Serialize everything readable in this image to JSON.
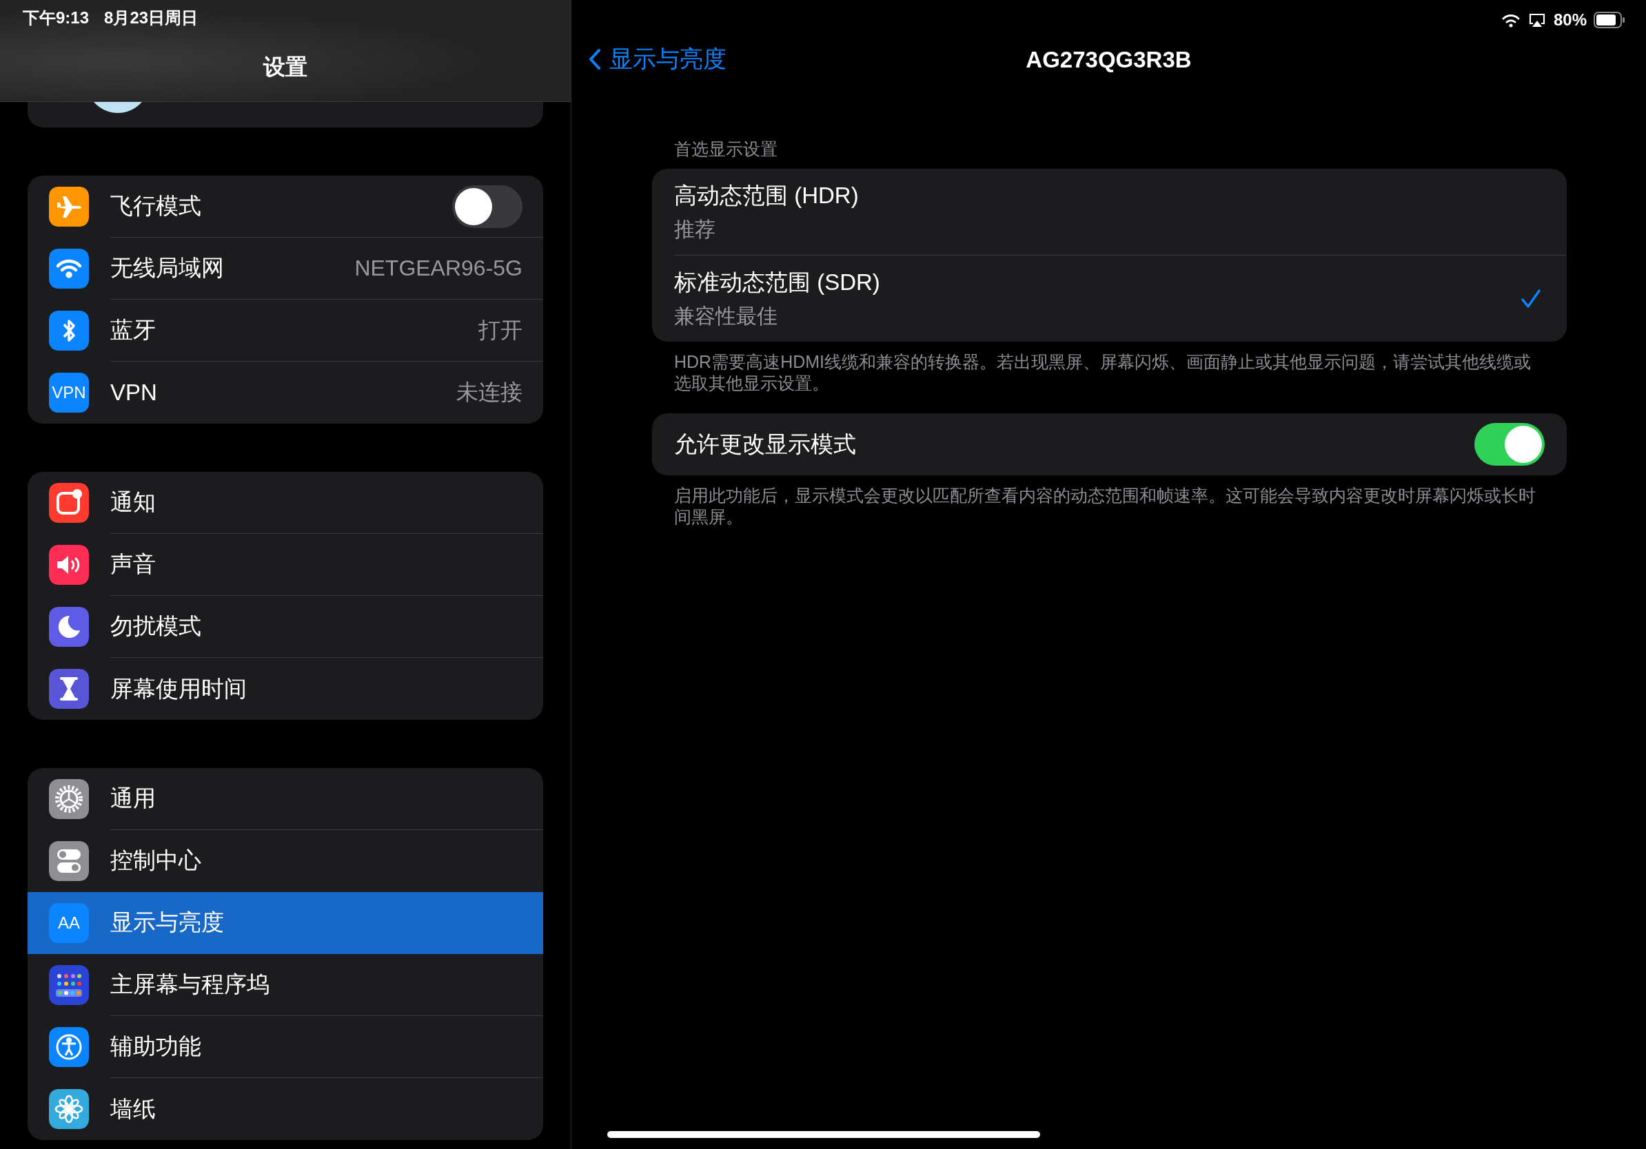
{
  "status_bar": {
    "time": "下午9:13",
    "date": "8月23日周日",
    "battery": "80%"
  },
  "sidebar": {
    "title": "设置",
    "groups": [
      {
        "items": [
          {
            "kind": "toggle",
            "label": "飞行模式",
            "on": false,
            "selected": false
          },
          {
            "kind": "value",
            "label": "无线局域网",
            "value": "NETGEAR96-5G",
            "selected": false
          },
          {
            "kind": "value",
            "label": "蓝牙",
            "value": "打开",
            "selected": false
          },
          {
            "kind": "value",
            "label": "VPN",
            "value": "未连接",
            "icon_text": "VPN",
            "selected": false
          }
        ]
      },
      {
        "items": [
          {
            "kind": "link",
            "label": "通知",
            "selected": false
          },
          {
            "kind": "link",
            "label": "声音",
            "selected": false
          },
          {
            "kind": "link",
            "label": "勿扰模式",
            "selected": false
          },
          {
            "kind": "link",
            "label": "屏幕使用时间",
            "selected": false
          }
        ]
      },
      {
        "items": [
          {
            "kind": "link",
            "label": "通用",
            "selected": false
          },
          {
            "kind": "link",
            "label": "控制中心",
            "selected": false
          },
          {
            "kind": "link",
            "label": "显示与亮度",
            "icon_text": "AA",
            "selected": true
          },
          {
            "kind": "link",
            "label": "主屏幕与程序坞",
            "selected": false
          },
          {
            "kind": "link",
            "label": "辅助功能",
            "selected": false
          },
          {
            "kind": "link",
            "label": "墙纸",
            "selected": false
          }
        ]
      }
    ]
  },
  "detail": {
    "back": "显示与亮度",
    "title": "AG273QG3R3B",
    "sections": [
      {
        "kind": "options",
        "header": "首选显示设置",
        "options": [
          {
            "title": "高动态范围 (HDR)",
            "subtitle": "推荐",
            "selected": false
          },
          {
            "title": "标准动态范围 (SDR)",
            "subtitle": "兼容性最佳",
            "selected": true
          }
        ],
        "footer": "HDR需要高速HDMI线缆和兼容的转换器。若出现黑屏、屏幕闪烁、画面静止或其他显示问题，请尝试其他线缆或选取其他显示设置。"
      },
      {
        "kind": "toggles",
        "rows": [
          {
            "label": "允许更改显示模式",
            "on": true
          }
        ],
        "footer": "启用此功能后，显示模式会更改以匹配所查看内容的动态范围和帧速率。这可能会导致内容更改时屏幕闪烁或长时间黑屏。"
      }
    ]
  }
}
